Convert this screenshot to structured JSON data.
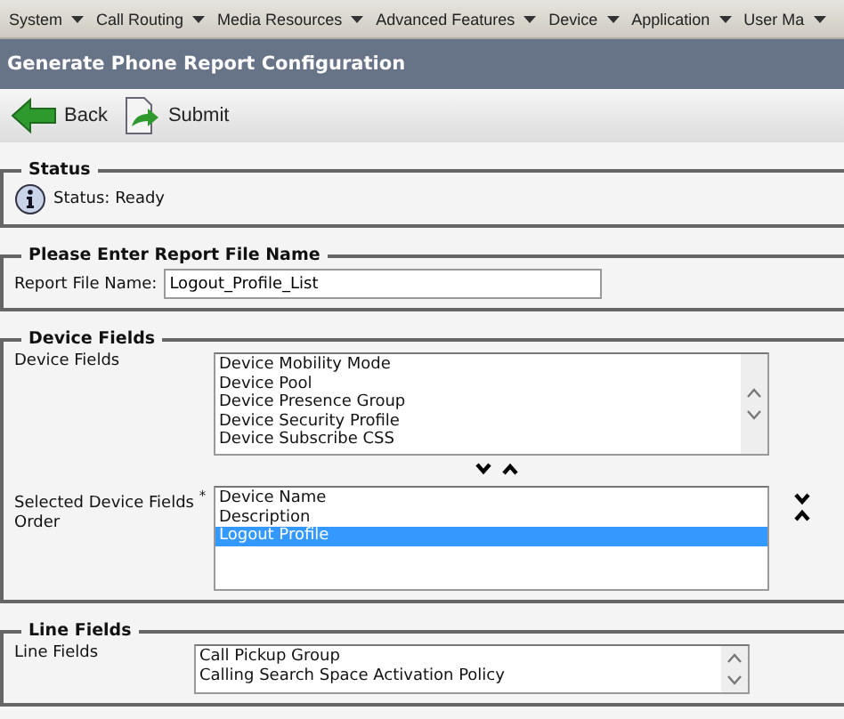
{
  "menu": [
    {
      "label": "System"
    },
    {
      "label": "Call Routing"
    },
    {
      "label": "Media Resources"
    },
    {
      "label": "Advanced Features"
    },
    {
      "label": "Device"
    },
    {
      "label": "Application"
    },
    {
      "label": "User Ma"
    }
  ],
  "title": "Generate Phone Report Configuration",
  "toolbar": [
    {
      "kind": "back",
      "label": "Back"
    },
    {
      "kind": "submit",
      "label": "Submit"
    }
  ],
  "status": {
    "legend": "Status",
    "text": "Status: Ready"
  },
  "report": {
    "legend": "Please Enter Report File Name",
    "label": "Report File Name:",
    "value": "Logout_Profile_List"
  },
  "device_fields": {
    "legend": "Device Fields",
    "available_label": "Device Fields",
    "available": [
      {
        "label": "Device Mobility Mode",
        "selected": false
      },
      {
        "label": "Device Pool",
        "selected": false
      },
      {
        "label": "Device Presence Group",
        "selected": false
      },
      {
        "label": "Device Security Profile",
        "selected": false
      },
      {
        "label": "Device Subscribe CSS",
        "selected": false
      }
    ],
    "selected_label": "Selected Device Fields",
    "required_mark": "*",
    "selected_label_2": "Order",
    "chosen": [
      {
        "label": "Device Name",
        "selected": false
      },
      {
        "label": "Description",
        "selected": false
      },
      {
        "label": "Logout Profile",
        "selected": true
      }
    ]
  },
  "line_fields": {
    "legend": "Line Fields",
    "available_label": "Line Fields",
    "available": [
      {
        "label": "Call Pickup Group",
        "selected": false
      },
      {
        "label": "Calling Search Space Activation Policy",
        "selected": false
      }
    ]
  }
}
